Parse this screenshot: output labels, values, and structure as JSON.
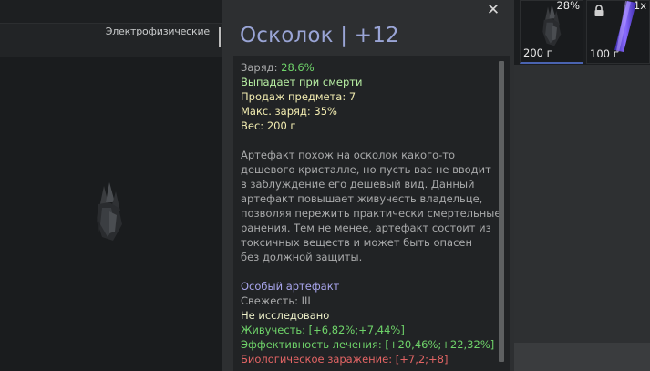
{
  "left_panel": {
    "category_label": "Электрофизические"
  },
  "tooltip": {
    "title": "Осколок | +12",
    "close_symbol": "✕",
    "charge_label": "Заряд:",
    "charge_value": "28.6%",
    "drop_on_death": "Выпадает при смерти",
    "sell_label": "Продаж предмета: 7",
    "max_charge": "Макс. заряд: 35%",
    "weight": "Вес: 200 г",
    "description_lines": [
      "Артефакт похож на осколок какого-то",
      "дешевого кристалле, но пусть вас не вводит",
      "в заблуждение его дешевый вид. Данный",
      "артефакт повышает живучесть владельце,",
      "позволяя пережить практически смертельные",
      "ранения. Тем не менее, артефакт состоит из",
      "токсичных веществ и может быть опасен",
      "без должной защиты."
    ],
    "special": "Особый артефакт",
    "freshness": "Свежесть: III",
    "not_researched": "Не исследовано",
    "stat_vitality": "Живучесть: [+6,82%;+7,44%]",
    "stat_healing": "Эффективность лечения: [+20,46%;+22,32%]",
    "stat_bio": "Биологическое заражение: [+7,2;+8]"
  },
  "inventory": {
    "slot1": {
      "charge": "28%",
      "weight": "200 г",
      "icon": "crystal-artifact-icon"
    },
    "slot2": {
      "count": "1x",
      "weight": "100 г",
      "icon": "glow-stick-icon",
      "locked": true
    }
  },
  "colors": {
    "title": "#9aa5d6",
    "green": "#6fd46a",
    "yellow": "#f3edb1",
    "purple": "#a9a6ee",
    "red": "#e46565",
    "selection": "#4a63b0"
  }
}
